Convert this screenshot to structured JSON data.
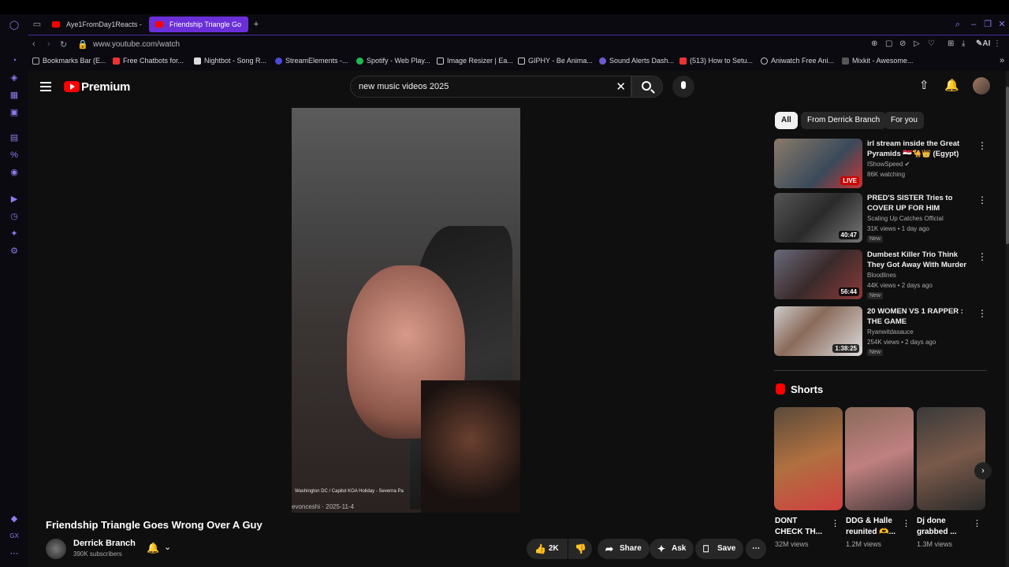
{
  "browser": {
    "tabs": [
      {
        "label": "Aye1FromDay1Reacts - Yo",
        "active": false
      },
      {
        "label": "Friendship Triangle Go",
        "active": true
      }
    ],
    "url": "www.youtube.com/watch",
    "bookmarks": [
      "Bookmarks Bar (E...",
      "Free Chatbots for...",
      "Nightbot - Song R...",
      "StreamElements -...",
      "Spotify - Web Play...",
      "Image Resizer | Ea...",
      "GIPHY - Be Anima...",
      "Sound Alerts Dash...",
      "(513) How to Setu...",
      "Aniwatch Free Ani...",
      "Mixkit - Awesome..."
    ],
    "ai_label": "AI"
  },
  "youtube": {
    "logo_text": "Premium",
    "search_value": "new music videos 2025",
    "video": {
      "caption": "Washington DC / Capitol KOA Holiday - Severna Pa",
      "credit": "evonceshi · 2025-11-4",
      "title": "Friendship Triangle Goes Wrong Over A Guy",
      "channel": "Derrick Branch",
      "subscribers": "390K subscribers",
      "likes": "2K",
      "share": "Share",
      "ask": "Ask",
      "save": "Save"
    },
    "chips": [
      "All",
      "From Derrick Branch",
      "For you"
    ],
    "recommendations": [
      {
        "title": "irl stream inside the Great Pyramids 🇪🇬🐪👑 (Egypt)",
        "channel": "IShowSpeed ✔",
        "meta": "86K watching",
        "badge": "LIVE",
        "new": ""
      },
      {
        "title": "PRED'S SISTER Tries to COVER UP FOR HIM",
        "channel": "Scaling Up Catches Official",
        "meta": "31K views • 1 day ago",
        "badge": "40:47",
        "new": "New"
      },
      {
        "title": "Dumbest Killer Trio Think They Got Away With Murder (They ...",
        "channel": "Bloodlines",
        "meta": "44K views • 2 days ago",
        "badge": "56:44",
        "new": "New"
      },
      {
        "title": "20 WOMEN VS 1 RAPPER : THE GAME",
        "channel": "Ryanwitdasauce",
        "meta": "254K views • 2 days ago",
        "badge": "1:38:25",
        "new": "New"
      }
    ],
    "shorts_heading": "Shorts",
    "shorts": [
      {
        "title": "DONT CHECK TH...",
        "views": "32M views"
      },
      {
        "title": "DDG & Halle reunited 🫶...",
        "views": "1.2M views"
      },
      {
        "title": "Dj done grabbed ...",
        "views": "1.3M views"
      }
    ]
  },
  "colors": {
    "accent": "#6b2fd8",
    "yt_red": "#ff0000",
    "bg": "#0f0f0f"
  }
}
